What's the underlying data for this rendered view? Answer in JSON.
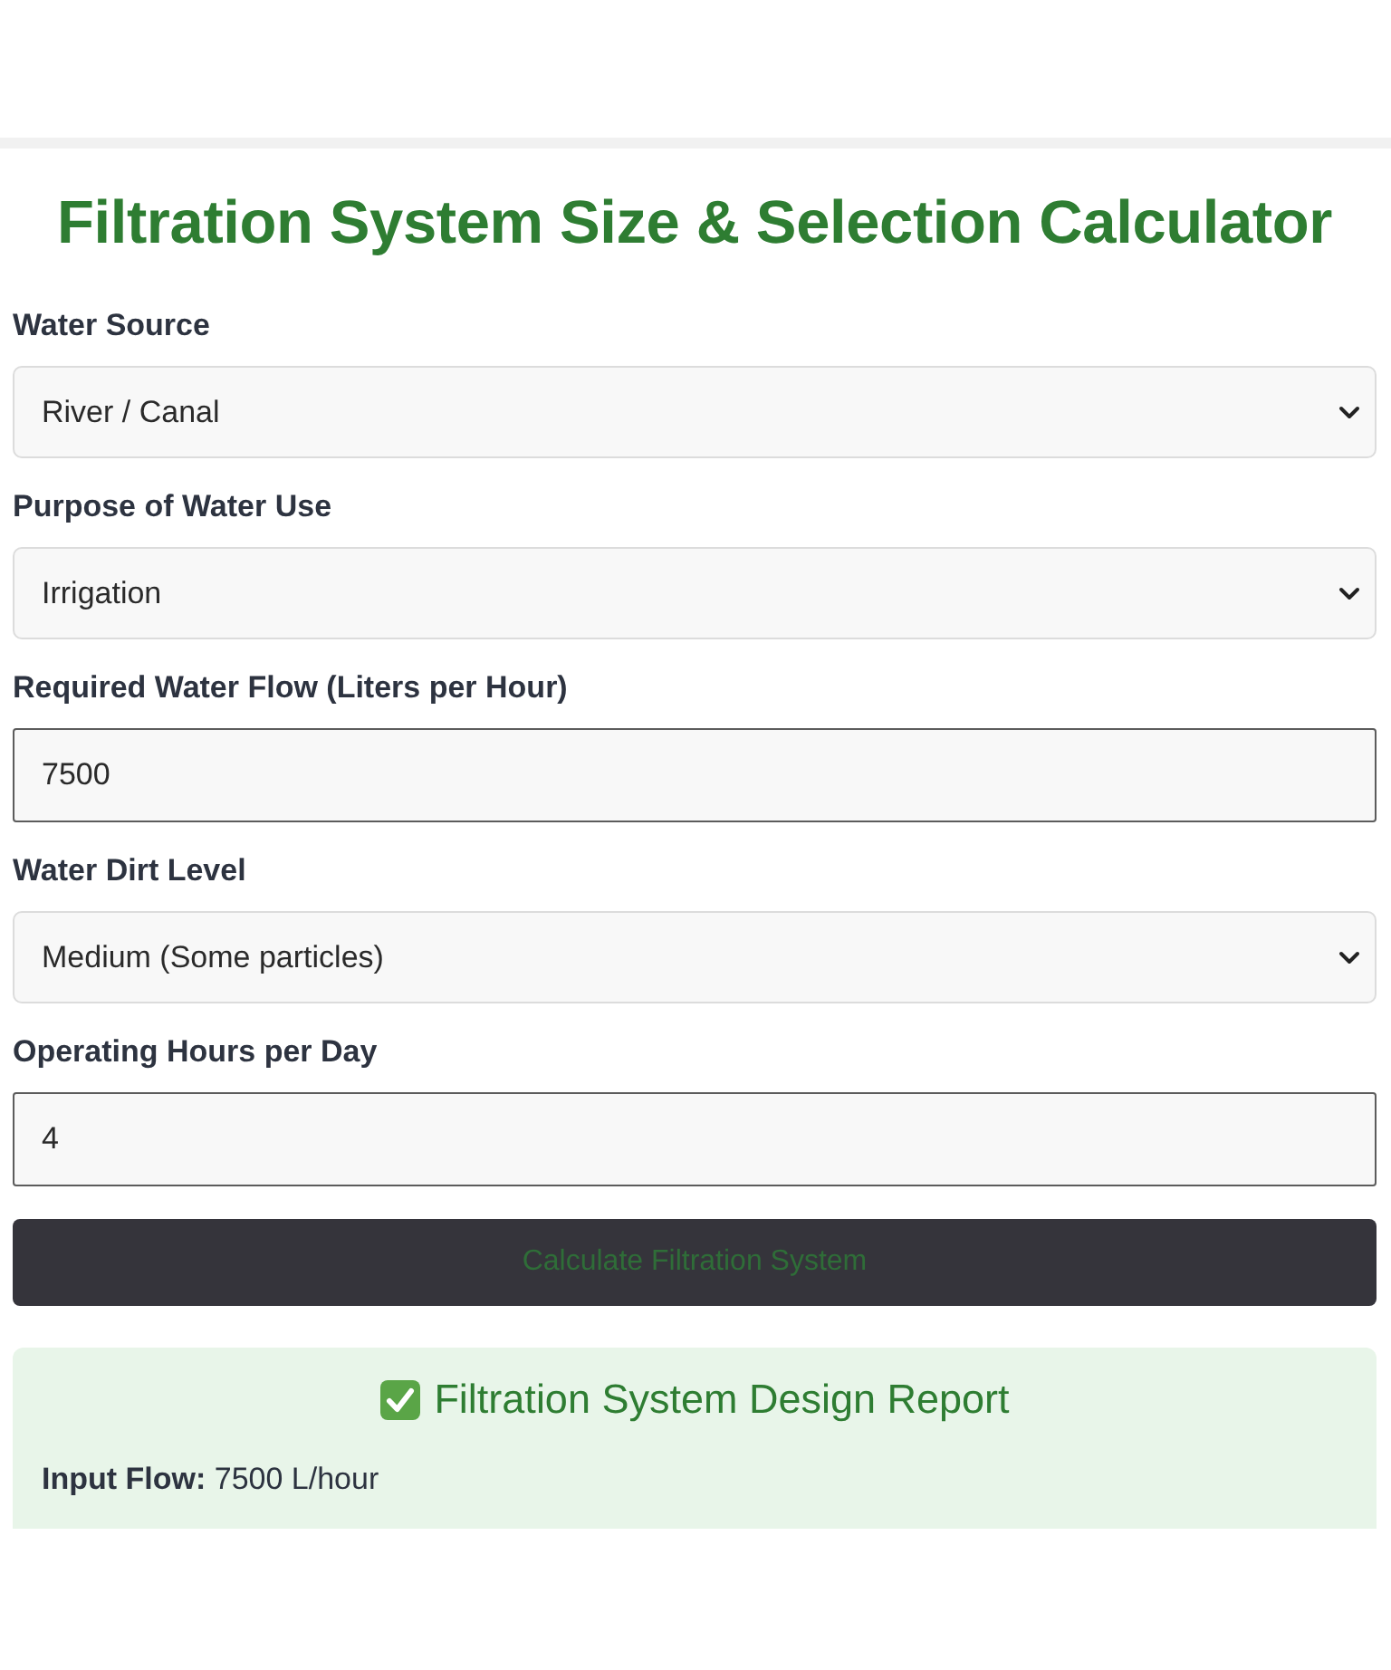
{
  "title": "Filtration System Size & Selection Calculator",
  "fields": [
    {
      "kind": "select",
      "label": "Water Source",
      "value": "River / Canal"
    },
    {
      "kind": "select",
      "label": "Purpose of Water Use",
      "value": "Irrigation"
    },
    {
      "kind": "input",
      "label": "Required Water Flow (Liters per Hour)",
      "value": "7500"
    },
    {
      "kind": "select",
      "label": "Water Dirt Level",
      "value": "Medium (Some particles)"
    },
    {
      "kind": "input",
      "label": "Operating Hours per Day",
      "value": "4"
    }
  ],
  "button": {
    "label": "Calculate Filtration System"
  },
  "report": {
    "title": "Filtration System Design Report",
    "lines": [
      "**Input Flow:** 7500 L/hour"
    ]
  }
}
